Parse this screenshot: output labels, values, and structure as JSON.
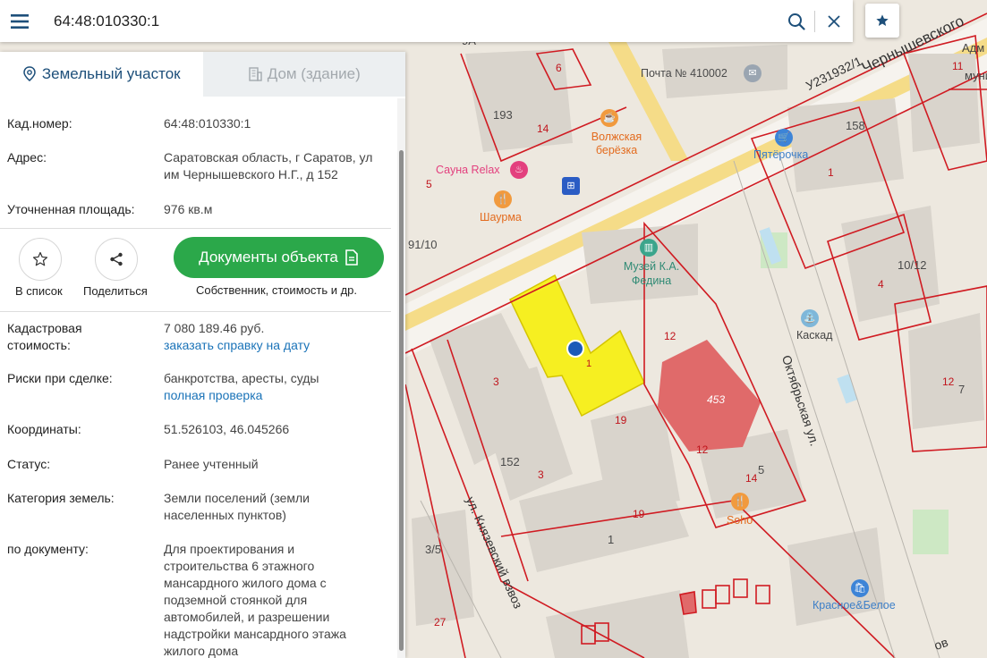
{
  "search": {
    "query": "64:48:010330:1",
    "menu_icon": "hamburger-icon",
    "search_icon": "search-icon",
    "clear_icon": "close-icon",
    "bookmark_icon": "star-icon"
  },
  "tabs": [
    {
      "label": "Земельный участок",
      "icon": "location-pin-icon",
      "active": true
    },
    {
      "label": "Дом (здание)",
      "icon": "building-icon",
      "active": false
    }
  ],
  "info": {
    "cad_number_label": "Кад.номер:",
    "cad_number_value": "64:48:010330:1",
    "address_label": "Адрес:",
    "address_value": "Саратовская область, г Саратов, ул им Чернышевского Н.Г., д 152",
    "area_label": "Уточненная площадь:",
    "area_value": "976 кв.м"
  },
  "actions": {
    "save_label": "В список",
    "share_label": "Поделиться",
    "docs_button": "Документы объекта",
    "docs_sub": "Собственник, стоимость и др."
  },
  "details": {
    "cost_label": "Кадастровая стоимость:",
    "cost_value": "7 080 189.46 руб.",
    "cost_link": "заказать справку на дату",
    "risks_label": "Риски при сделке:",
    "risks_value": "банкротства, аресты, суды",
    "risks_link": "полная проверка",
    "coords_label": "Координаты:",
    "coords_value": "51.526103, 46.045266",
    "status_label": "Статус:",
    "status_value": "Ранее учтенный",
    "category_label": "Категория земель:",
    "category_value": "Земли поселений (земли населенных пунктов)",
    "doc_label": "по документу:",
    "doc_value": "Для проектирования и строительства 6 этажного мансардного жилого дома с подземной стоянкой для автомобилей, и разрешении надстройки мансардного этажа жилого дома"
  },
  "map": {
    "street_chern": "Чернышевского",
    "street_u": "У231932/1",
    "street_okt": "Октябрьская ул.",
    "street_knyaz": "ул. Князевский взвоз",
    "street_bottom": "ов",
    "pochta": "Почта № 410002",
    "volzhskaya": "Волжская берёзка",
    "sauna": "Сауна Relax",
    "sharma": "Шаурма",
    "pyaterochka": "Пятёрочка",
    "muzey": "Музей К.А. Федина",
    "kaskad": "Каскад",
    "soho": "Soho",
    "krasnoe": "Красное&Белое",
    "adm": "Адм",
    "mun": "муни",
    "numbers": {
      "n193": "193",
      "n14a": "14",
      "n6": "6",
      "n9a": "9А",
      "n5": "5",
      "n91": "91/10",
      "n158": "158",
      "n1a": "1",
      "n11": "11",
      "n1012": "10/12",
      "n4": "4",
      "n12a": "12",
      "n7": "7",
      "n3a": "3",
      "n1b": "1",
      "n12b": "12",
      "n453": "453",
      "n19a": "19",
      "n12c": "12",
      "n152": "152",
      "n3b": "3",
      "n5b": "5",
      "n14b": "14",
      "n19b": "19",
      "n1c": "1",
      "n35": "3/5",
      "n27": "27"
    }
  },
  "colors": {
    "accent": "#1d4f7a",
    "link": "#1a73b8",
    "docs_button": "#2ba84a",
    "parcel_fill": "#f7f000",
    "boundary": "#d01b22",
    "building_highlight": "#e06a6a"
  }
}
